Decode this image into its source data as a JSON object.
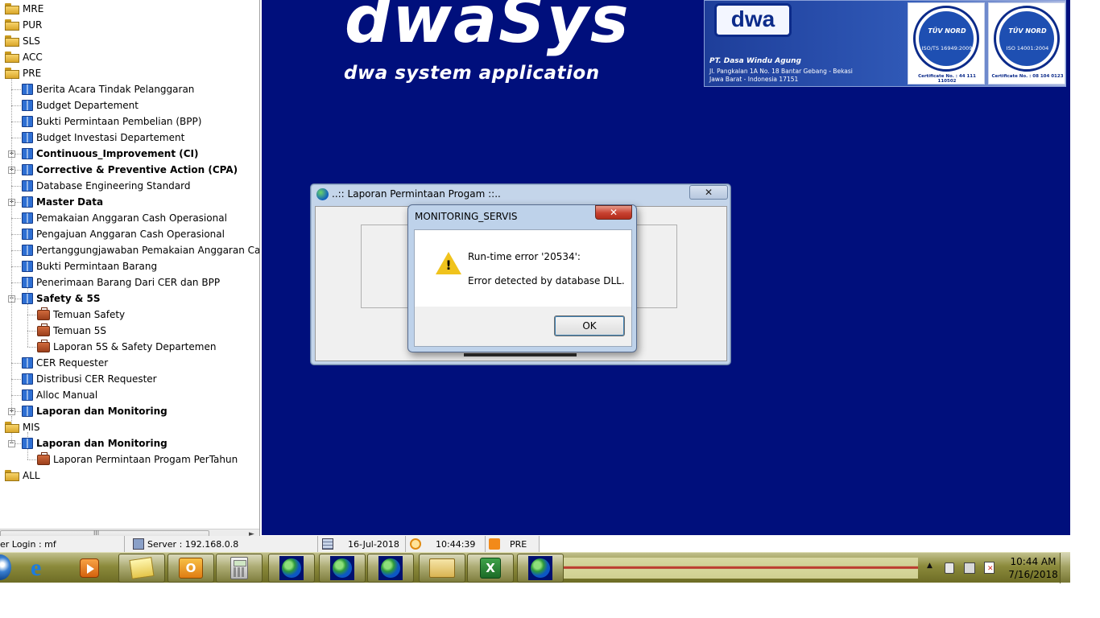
{
  "app": {
    "logo_title": "dwaSys",
    "logo_subtitle": "dwa system application"
  },
  "banner": {
    "logo_text": "dwa",
    "company_name": "PT. Dasa Windu Agung",
    "address_line1": "Jl. Pangkalan 1A No. 18 Bantar Gebang - Bekasi",
    "address_line2": "Jawa Barat - Indonesia 17151",
    "certificates": [
      {
        "brand": "TÜV NORD",
        "standard": "ISO/TS 16949:2009",
        "number": "Certificate No. : 44 111 110502"
      },
      {
        "brand": "TÜV NORD",
        "standard": "ISO 14001:2004",
        "number": "Certificate No. : 08 104 0123"
      }
    ]
  },
  "tree": {
    "items": [
      {
        "label": "MRE",
        "icon": "folder-icon",
        "bold": false
      },
      {
        "label": "PUR",
        "icon": "folder-icon",
        "bold": false
      },
      {
        "label": "SLS",
        "icon": "folder-icon",
        "bold": false
      },
      {
        "label": "ACC",
        "icon": "folder-icon",
        "bold": false
      },
      {
        "label": "PRE",
        "icon": "folder-open-icon",
        "bold": false
      },
      {
        "label": "Berita Acara Tindak Pelanggaran",
        "icon": "book-icon",
        "bold": false
      },
      {
        "label": "Budget Departement",
        "icon": "book-icon",
        "bold": false
      },
      {
        "label": "Bukti Permintaan Pembelian (BPP)",
        "icon": "book-icon",
        "bold": false
      },
      {
        "label": "Budget Investasi Departement",
        "icon": "book-icon",
        "bold": false
      },
      {
        "label": "Continuous_Improvement (CI)",
        "icon": "book-icon",
        "bold": true,
        "expander": "+"
      },
      {
        "label": "Corrective & Preventive Action (CPA)",
        "icon": "book-icon",
        "bold": true,
        "expander": "+"
      },
      {
        "label": "Database Engineering Standard",
        "icon": "book-icon",
        "bold": false
      },
      {
        "label": "Master Data",
        "icon": "book-icon",
        "bold": true,
        "expander": "+"
      },
      {
        "label": "Pemakaian Anggaran Cash Operasional",
        "icon": "book-icon",
        "bold": false
      },
      {
        "label": "Pengajuan Anggaran Cash Operasional",
        "icon": "book-icon",
        "bold": false
      },
      {
        "label": "Pertanggungjawaban Pemakaian Anggaran Cash Op",
        "icon": "book-icon",
        "bold": false
      },
      {
        "label": "Bukti Permintaan Barang",
        "icon": "book-icon",
        "bold": false
      },
      {
        "label": "Penerimaan Barang Dari CER dan BPP",
        "icon": "book-icon",
        "bold": false
      },
      {
        "label": "Safety & 5S",
        "icon": "book-icon",
        "bold": true,
        "expander": "-"
      },
      {
        "label": "Temuan Safety",
        "icon": "briefcase-icon",
        "bold": false
      },
      {
        "label": "Temuan 5S",
        "icon": "briefcase-icon",
        "bold": false
      },
      {
        "label": "Laporan 5S & Safety Departemen",
        "icon": "briefcase-icon",
        "bold": false
      },
      {
        "label": "CER Requester",
        "icon": "book-icon",
        "bold": false
      },
      {
        "label": "Distribusi CER Requester",
        "icon": "book-icon",
        "bold": false
      },
      {
        "label": "Alloc Manual",
        "icon": "book-icon",
        "bold": false
      },
      {
        "label": "Laporan dan Monitoring",
        "icon": "book-icon",
        "bold": true,
        "expander": "+"
      },
      {
        "label": "MIS",
        "icon": "folder-open-icon",
        "bold": false
      },
      {
        "label": "Laporan dan Monitoring",
        "icon": "book-icon",
        "bold": true,
        "expander": "-"
      },
      {
        "label": "Laporan Permintaan Progam PerTahun",
        "icon": "briefcase-icon",
        "bold": false
      },
      {
        "label": "ALL",
        "icon": "folder-icon",
        "bold": false
      }
    ],
    "scroll_grip": "III"
  },
  "status_bar": {
    "user_login": "er Login : mf",
    "server": "Server : 192.168.0.8",
    "date": "16-Jul-2018",
    "time": "10:44:39",
    "module": "PRE"
  },
  "bg_window": {
    "title": "..:: Laporan Permintaan Progam ::..",
    "close_label": "✕"
  },
  "dialog": {
    "title": "MONITORING_SERVIS",
    "close_label": "✕",
    "line1": "Run-time error '20534':",
    "line2": "Error detected by database DLL.",
    "ok_label": "OK"
  },
  "taskbar": {
    "clock_time": "10:44 AM",
    "clock_date": "7/16/2018",
    "outlook_letter": "O",
    "excel_letter": "X"
  }
}
